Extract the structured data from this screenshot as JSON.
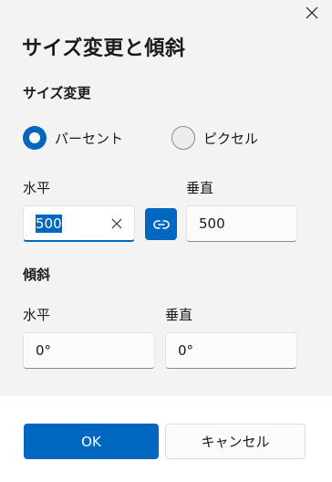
{
  "dialog": {
    "title": "サイズ変更と傾斜",
    "close_icon": "close-icon"
  },
  "resize": {
    "heading": "サイズ変更",
    "mode_options": [
      {
        "label": "パーセント",
        "selected": true
      },
      {
        "label": "ピクセル",
        "selected": false
      }
    ],
    "horizontal": {
      "label": "水平",
      "value": "500"
    },
    "vertical": {
      "label": "垂直",
      "value": "500"
    },
    "aspect_lock_icon": "link-icon"
  },
  "skew": {
    "heading": "傾斜",
    "horizontal": {
      "label": "水平",
      "value": "0°"
    },
    "vertical": {
      "label": "垂直",
      "value": "0°"
    }
  },
  "footer": {
    "ok_label": "OK",
    "cancel_label": "キャンセル"
  },
  "colors": {
    "accent": "#0067c0",
    "surface": "#f3f3f3",
    "footer": "#ffffff"
  }
}
